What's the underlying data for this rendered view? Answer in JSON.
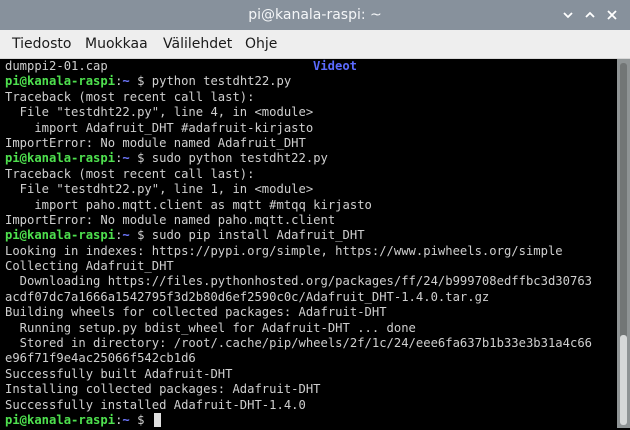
{
  "window": {
    "title": "pi@kanala-raspi: ~",
    "controls": [
      "minimize",
      "maximize",
      "close"
    ]
  },
  "menu": {
    "items": [
      "Tiedosto",
      "Muokkaa",
      "Välilehdet",
      "Ohje"
    ]
  },
  "terminal": {
    "prompt_user": "pi@kanala-raspi",
    "prompt_sep": ":",
    "prompt_path": "~",
    "prompt_symbol": "$",
    "lines": [
      {
        "type": "text",
        "text": "dumppi2-01.cap",
        "right": "Videot"
      },
      {
        "type": "prompt",
        "cmd": " python testdht22.py"
      },
      {
        "type": "text",
        "text": "Traceback (most recent call last):"
      },
      {
        "type": "text",
        "text": "  File \"testdht22.py\", line 4, in <module>"
      },
      {
        "type": "text",
        "text": "    import Adafruit_DHT #adafruit-kirjasto"
      },
      {
        "type": "text",
        "text": "ImportError: No module named Adafruit_DHT"
      },
      {
        "type": "prompt",
        "cmd": " sudo python testdht22.py"
      },
      {
        "type": "text",
        "text": "Traceback (most recent call last):"
      },
      {
        "type": "text",
        "text": "  File \"testdht22.py\", line 1, in <module>"
      },
      {
        "type": "text",
        "text": "    import paho.mqtt.client as mqtt #mtqq kirjasto"
      },
      {
        "type": "text",
        "text": "ImportError: No module named paho.mqtt.client"
      },
      {
        "type": "prompt",
        "cmd": " sudo pip install Adafruit_DHT"
      },
      {
        "type": "text",
        "text": "Looking in indexes: https://pypi.org/simple, https://www.piwheels.org/simple"
      },
      {
        "type": "text",
        "text": "Collecting Adafruit_DHT"
      },
      {
        "type": "text",
        "text": "  Downloading https://files.pythonhosted.org/packages/ff/24/b999708edffbc3d30763"
      },
      {
        "type": "text",
        "text": "acdf07dc7a1666a1542795f3d2b80d6ef2590c0c/Adafruit_DHT-1.4.0.tar.gz"
      },
      {
        "type": "text",
        "text": "Building wheels for collected packages: Adafruit-DHT"
      },
      {
        "type": "text",
        "text": "  Running setup.py bdist_wheel for Adafruit-DHT ... done"
      },
      {
        "type": "text",
        "text": "  Stored in directory: /root/.cache/pip/wheels/2f/1c/24/eee6fa637b1b33e3b31a4c66"
      },
      {
        "type": "text",
        "text": "e96f71f9e4ac25066f542cb1d6"
      },
      {
        "type": "text",
        "text": "Successfully built Adafruit-DHT"
      },
      {
        "type": "text",
        "text": "Installing collected packages: Adafruit-DHT"
      },
      {
        "type": "text",
        "text": "Successfully installed Adafruit-DHT-1.4.0"
      },
      {
        "type": "prompt",
        "cmd": " ",
        "cursor": true
      }
    ]
  },
  "colors": {
    "prompt_user": "#4ee04e",
    "prompt_path": "#6f78ff",
    "terminal_bg": "#000000",
    "terminal_fg": "#cfcfcf",
    "titlebar_bg": "#87919c",
    "menubar_bg": "#eeeeee"
  },
  "scrollbar": {
    "position_fraction": 1.0
  }
}
